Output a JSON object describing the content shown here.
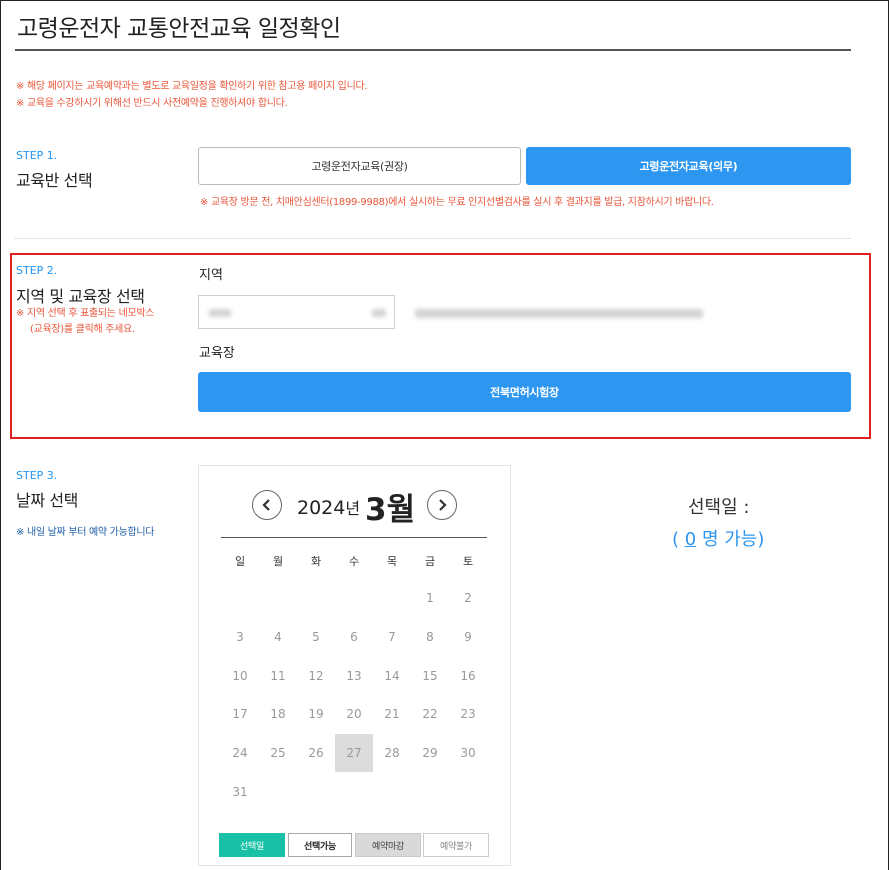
{
  "page": {
    "title": "고령운전자 교통안전교육 일정확인",
    "notices": [
      "※ 해당 페이지는 교육예약과는 별도로 교육일정을 확인하기 위한 참고용 페이지 입니다.",
      "※ 교육을 수강하시기 위해선 반드시 사전예약을 진행하셔야 합니다."
    ]
  },
  "step1": {
    "label": "STEP 1.",
    "title": "교육반 선택",
    "options": [
      "고령운전자교육(권장)",
      "고령운전자교육(의무)"
    ],
    "selected_index": 1,
    "note": "※ 교육장 방문 전, 치매안심센터(1899-9988)에서 실시하는 무료 인지선별검사를 실시 후 결과지를 발급, 지참하시기 바랍니다."
  },
  "step2": {
    "label": "STEP 2.",
    "title": "지역 및 교육장 선택",
    "note_line1": "※ 지역 선택 후 표출되는 네모박스",
    "note_line2": "(교육장)를 클릭해 주세요.",
    "region_label": "지역",
    "center_label": "교육장",
    "center_button": "전북면허시험장"
  },
  "step3": {
    "label": "STEP 3.",
    "title": "날짜 선택",
    "note": "※ 내일 날짜 부터 예약 가능합니다"
  },
  "calendar": {
    "year": "2024",
    "year_suffix": "년",
    "month": "3월",
    "weekdays": [
      "일",
      "월",
      "화",
      "수",
      "목",
      "금",
      "토"
    ],
    "days": [
      [
        "",
        "",
        "",
        "",
        "",
        "1",
        "2"
      ],
      [
        "3",
        "4",
        "5",
        "6",
        "7",
        "8",
        "9"
      ],
      [
        "10",
        "11",
        "12",
        "13",
        "14",
        "15",
        "16"
      ],
      [
        "17",
        "18",
        "19",
        "20",
        "21",
        "22",
        "23"
      ],
      [
        "24",
        "25",
        "26",
        "27",
        "28",
        "29",
        "30"
      ],
      [
        "31",
        "",
        "",
        "",
        "",
        "",
        ""
      ]
    ],
    "highlighted_day": "27",
    "legend": [
      "선택일",
      "선택가능",
      "예약마감",
      "예약불가"
    ]
  },
  "selection": {
    "title": "선택일 :",
    "open": "(",
    "count": "0",
    "suffix": "명 가능)"
  },
  "colors": {
    "accent": "#2d96f0",
    "notice": "#e8563a",
    "highlight_box": "#e02020",
    "selected_legend": "#18c1a5"
  }
}
